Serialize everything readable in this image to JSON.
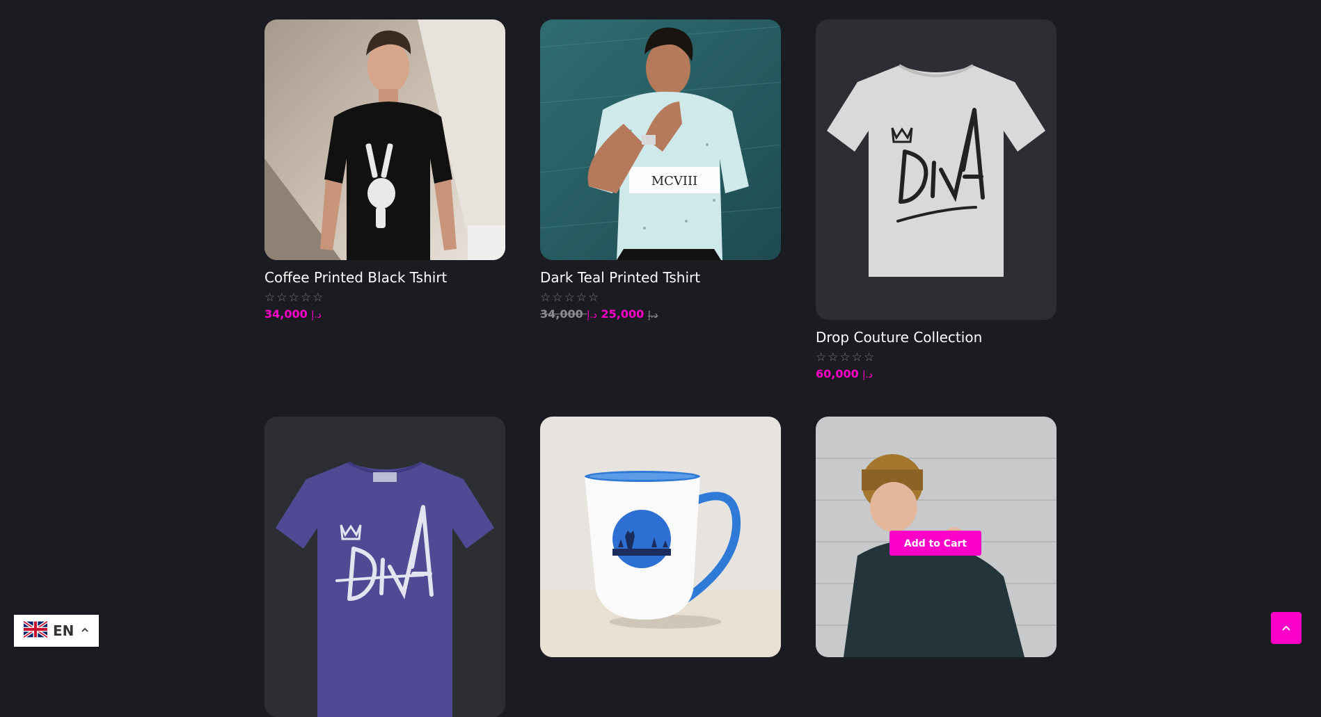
{
  "products": [
    {
      "title": "Coffee Printed Black Tshirt",
      "price": "34,000",
      "currency": "د.إ",
      "stars": "☆☆☆☆☆"
    },
    {
      "title": "Dark Teal Printed Tshirt",
      "old_price": "34,000",
      "old_currency": "د.إ",
      "price": "25,000",
      "currency": "د.إ",
      "stars": "☆☆☆☆☆"
    },
    {
      "title": "Drop Couture Collection",
      "price": "60,000",
      "currency": "د.إ",
      "stars": "☆☆☆☆☆"
    },
    {
      "logo_text": "DIVA"
    },
    {},
    {
      "add_to_cart": "Add to Cart"
    }
  ],
  "language": {
    "code": "EN"
  },
  "icons": {
    "flag": "uk-flag-icon",
    "lang_caret": "chevron-up-icon",
    "to_top": "chevron-up-icon",
    "star": "star-outline-icon"
  },
  "colors": {
    "accent": "#ff00c8",
    "background": "#1b1c22"
  }
}
